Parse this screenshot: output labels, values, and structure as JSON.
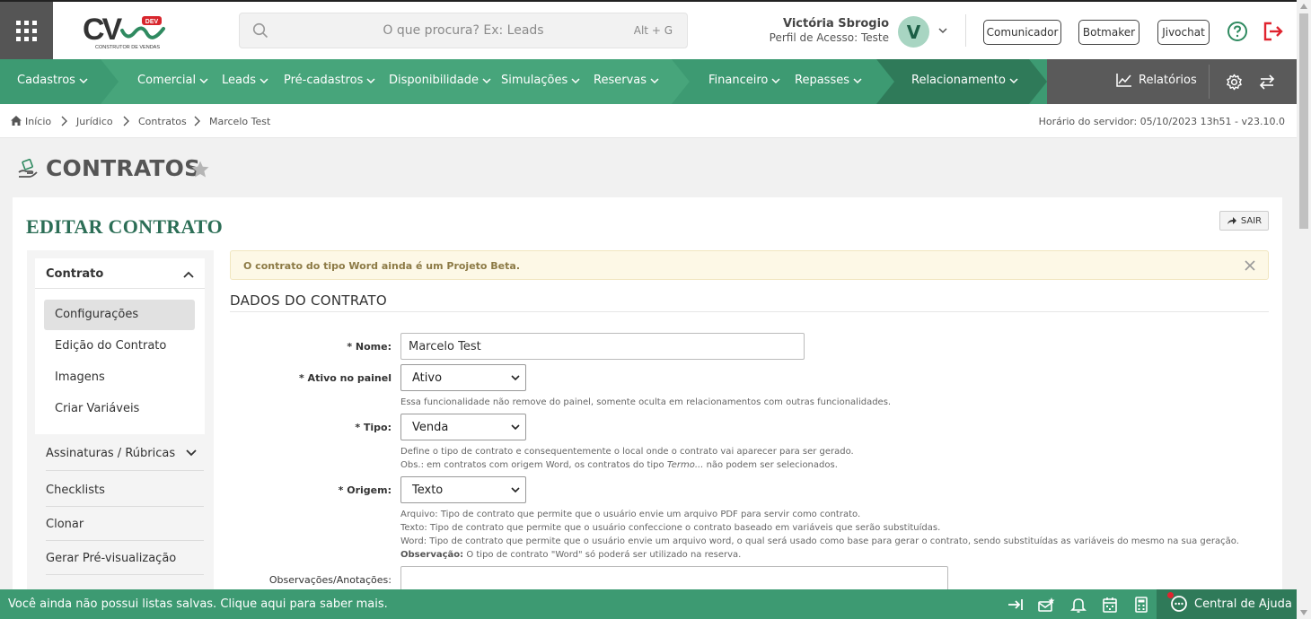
{
  "header": {
    "logo_text": "CV",
    "logo_badge": "DEV",
    "logo_sub": "CONSTRUTOR DE VENDAS",
    "search_placeholder": "O que procura? Ex: Leads",
    "search_shortcut": "Alt + G",
    "user_name": "Victória Sbrogio",
    "user_profile": "Perfil de Acesso: Teste",
    "avatar_letter": "V",
    "buttons": [
      "Comunicador",
      "Botmaker",
      "Jivochat"
    ]
  },
  "nav": {
    "items": [
      "Cadastros",
      "Comercial",
      "Leads",
      "Pré-cadastros",
      "Disponibilidade",
      "Simulações",
      "Reservas",
      "Financeiro",
      "Repasses",
      "Relacionamento"
    ],
    "reports": "Relatórios",
    "colors": {
      "green": "#3d9a72",
      "dark_green": "#2f7a59",
      "gray": "#5a5a5a"
    }
  },
  "breadcrumb": {
    "items": [
      "Início",
      "Jurídico",
      "Contratos",
      "Marcelo Test"
    ],
    "server_time": "Horário do servidor: 05/10/2023 13h51 - v23.10.0"
  },
  "page": {
    "title": "CONTRATOS",
    "card_title": "EDITAR CONTRATO",
    "exit_label": "SAIR"
  },
  "side_menu": {
    "section": "Contrato",
    "sub_items": [
      "Configurações",
      "Edição do Contrato",
      "Imagens",
      "Criar Variáveis"
    ],
    "items": [
      "Assinaturas / Rúbricas",
      "Checklists",
      "Clonar",
      "Gerar Pré-visualização"
    ]
  },
  "alert": {
    "text": "O contrato do tipo Word ainda é um Projeto Beta."
  },
  "form": {
    "section_title": "DADOS DO CONTRATO",
    "name_label": "* Nome:",
    "name_value": "Marcelo Test",
    "active_label": "* Ativo no painel",
    "active_value": "Ativo",
    "active_help": "Essa funcionalidade não remove do painel, somente oculta em relacionamentos com outras funcionalidades.",
    "type_label": "* Tipo:",
    "type_value": "Venda",
    "type_help_1": "Define o tipo de contrato e consequentemente o local onde o contrato vai aparecer para ser gerado.",
    "type_help_2a": "Obs.: em contratos com origem Word, os contratos do tipo ",
    "type_help_2b": "Termo...",
    "type_help_2c": " não podem ser selecionados.",
    "origin_label": "* Origem:",
    "origin_value": "Texto",
    "origin_help_1": "Arquivo: Tipo de contrato que permite que o usuário envie um arquivo PDF para servir como contrato.",
    "origin_help_2": "Texto: Tipo de contrato que permite que o usuário confeccione o contrato baseado em variáveis que serão substituídas.",
    "origin_help_3": "Word: Tipo de contrato que permite que o usuário envie um arquivo word, o qual será usado como base para gerar o contrato, sendo substituídas as variáveis do mesmo na sua geração.",
    "origin_help_4a": "Observação:",
    "origin_help_4b": " O tipo de contrato \"Word\" só poderá ser utilizado na reserva.",
    "notes_label": "Observações/Anotações:"
  },
  "bottom": {
    "saved_lists": "Você ainda não possui listas salvas. Clique aqui para saber mais.",
    "help_center": "Central de Ajuda"
  }
}
